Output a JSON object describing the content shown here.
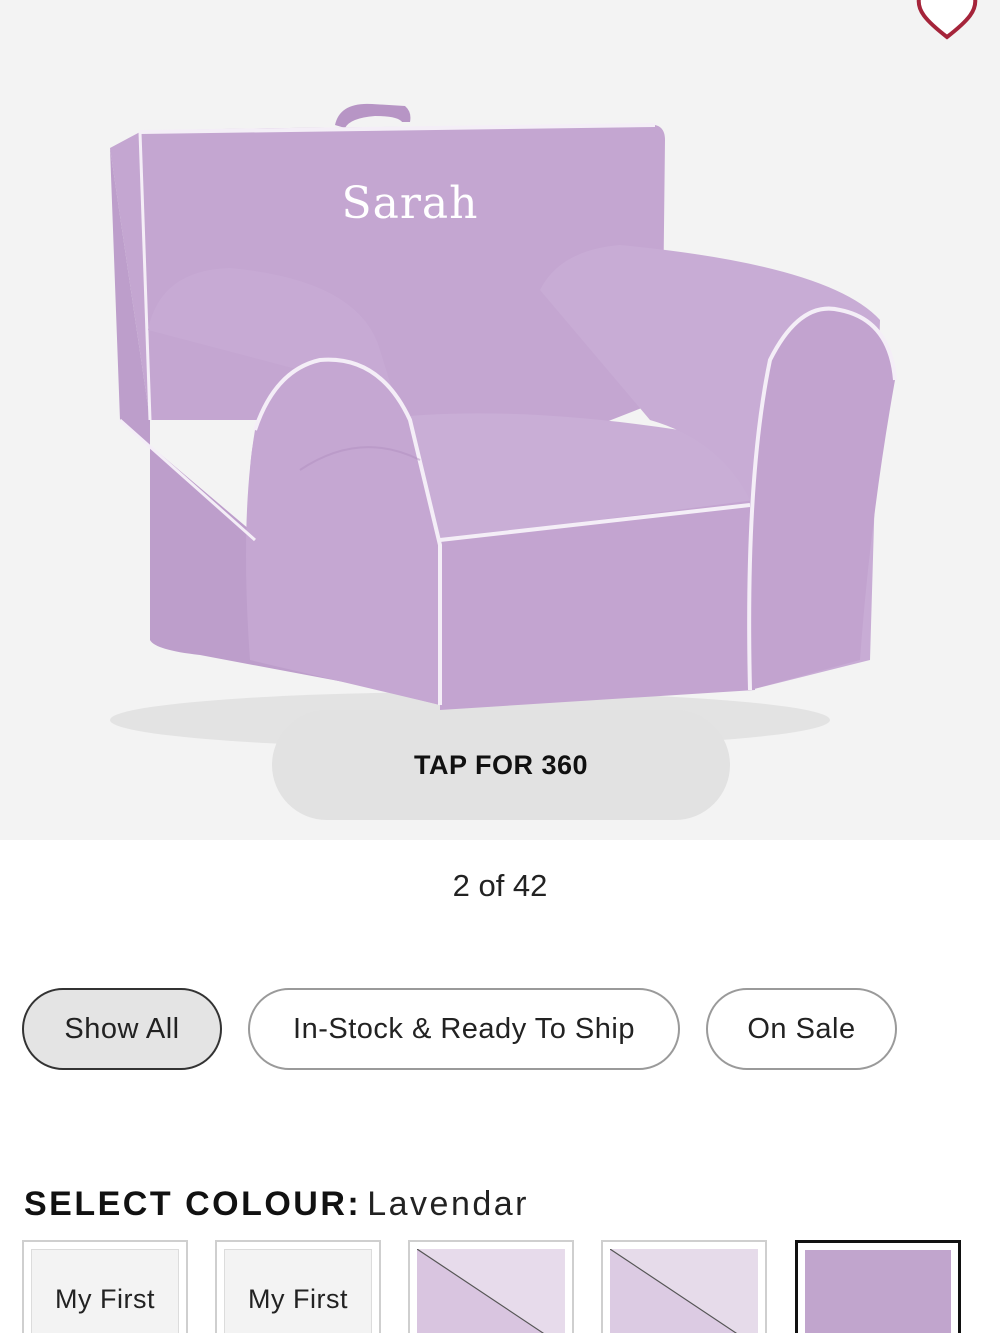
{
  "product": {
    "embroidery_text": "Sarah",
    "image_counter": "2 of 42",
    "tap_360_label": "TAP FOR 360",
    "favorite_icon": "heart-icon"
  },
  "filters": {
    "show_all": "Show All",
    "in_stock": "In-Stock & Ready To Ship",
    "on_sale": "On Sale"
  },
  "colour": {
    "label": "SELECT COLOUR:",
    "selected": "Lavendar",
    "swatches": [
      {
        "label": "My First"
      },
      {
        "label": "My First"
      },
      {
        "label": ""
      },
      {
        "label": ""
      },
      {
        "label": ""
      }
    ]
  },
  "colors": {
    "lavender": "#c8acd4",
    "lavender_dark": "#b795c5",
    "heart": "#a5243a"
  }
}
